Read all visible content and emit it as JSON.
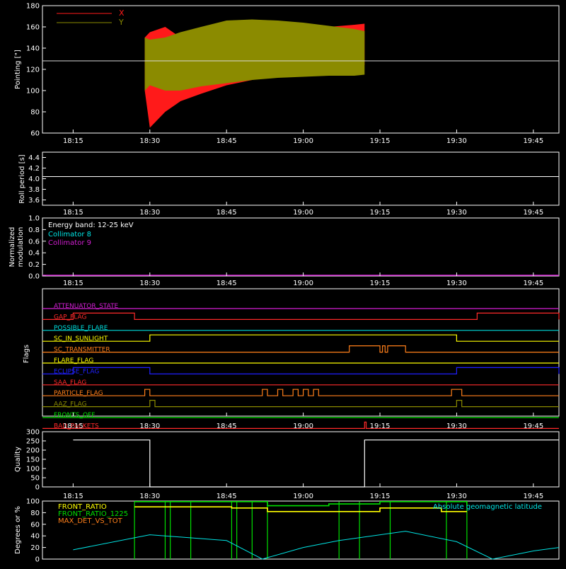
{
  "time_ticks": [
    "18:15",
    "18:30",
    "18:45",
    "19:00",
    "19:15",
    "19:30",
    "19:45"
  ],
  "colors": {
    "axis": "#ffffff",
    "x_series": "#ff1a1a",
    "y_series": "#8b8b00",
    "cyan": "#00e5e5",
    "magenta": "#d21fd2",
    "green": "#00e000",
    "yellow": "#ffff00",
    "orange": "#ff7f1a"
  },
  "chart_data": [
    {
      "type": "area",
      "id": "pointing",
      "ylabel": "Pointing [\"]",
      "ylim": [
        60,
        180
      ],
      "yticks": [
        "60",
        "80",
        "100",
        "120",
        "140",
        "160",
        "180"
      ],
      "legend": [
        {
          "name": "X",
          "color": "#ff1a1a"
        },
        {
          "name": "Y",
          "color": "#8b8b00"
        }
      ],
      "reference_line": 128,
      "data_start": "18:29",
      "data_end": "19:12",
      "series": [
        {
          "name": "X",
          "envelope": {
            "t": [
              "18:29",
              "18:30",
              "18:33",
              "18:36",
              "18:40",
              "18:45",
              "18:50",
              "18:55",
              "19:00",
              "19:05",
              "19:10",
              "19:12"
            ],
            "min": [
              100,
              65,
              80,
              90,
              97,
              105,
              110,
              115,
              118,
              121,
              123,
              124
            ],
            "max": [
              150,
              155,
              160,
              150,
              152,
              155,
              157,
              158,
              159,
              160,
              162,
              163
            ]
          }
        },
        {
          "name": "Y",
          "envelope": {
            "t": [
              "18:29",
              "18:30",
              "18:33",
              "18:36",
              "18:40",
              "18:45",
              "18:50",
              "18:55",
              "19:00",
              "19:05",
              "19:10",
              "19:12"
            ],
            "min": [
              100,
              105,
              100,
              100,
              104,
              107,
              110,
              112,
              113,
              114,
              114,
              115
            ],
            "max": [
              150,
              148,
              150,
              155,
              160,
              166,
              167,
              166,
              164,
              161,
              158,
              156
            ]
          }
        }
      ]
    },
    {
      "type": "line",
      "id": "roll",
      "ylabel": "Roll period [s]",
      "ylim": [
        3.5,
        4.5
      ],
      "yticks": [
        "3.6",
        "3.8",
        "4.0",
        "4.2",
        "4.4"
      ],
      "value": 4.04
    },
    {
      "type": "line",
      "id": "modulation",
      "ylabel": [
        "Normalized",
        "modulation"
      ],
      "ylim": [
        0,
        1
      ],
      "yticks": [
        "0.0",
        "0.2",
        "0.4",
        "0.6",
        "0.8",
        "1.0"
      ],
      "annotations": [
        {
          "text": "Energy band: 12-25 keV",
          "color": "#ffffff"
        },
        {
          "text": "Collimator 8",
          "color": "#00e5e5"
        },
        {
          "text": "Collimator 9",
          "color": "#d21fd2"
        }
      ],
      "baseline": 0
    },
    {
      "type": "line",
      "id": "flags",
      "ylabel": "Flags",
      "flags": [
        {
          "name": "ATTENUATOR_STATE",
          "color": "#d21fd2",
          "segments": []
        },
        {
          "name": "GAP_FLAG",
          "color": "#ff2a2a",
          "segments": [
            [
              "18:15",
              "18:27"
            ],
            [
              "19:34",
              "19:50"
            ]
          ]
        },
        {
          "name": "POSSIBLE_FLARE",
          "color": "#00dcdc",
          "segments": []
        },
        {
          "name": "SC_IN_SUNLIGHT",
          "color": "#ffff00",
          "segments": [
            [
              "18:30",
              "19:30"
            ]
          ]
        },
        {
          "name": "SC_TRANSMITTER",
          "color": "#ff7f1a",
          "segments": [
            [
              "19:09",
              "19:15"
            ],
            [
              "19:15.5",
              "19:16"
            ],
            [
              "19:16.5",
              "19:20"
            ]
          ]
        },
        {
          "name": "FLARE_FLAG",
          "color": "#ffff00",
          "segments": []
        },
        {
          "name": "ECLIPSE_FLAG",
          "color": "#2020ff",
          "segments": [
            [
              "18:15",
              "18:30"
            ],
            [
              "19:30",
              "19:50"
            ]
          ]
        },
        {
          "name": "SAA_FLAG",
          "color": "#ff2a2a",
          "segments": []
        },
        {
          "name": "PARTICLE_FLAG",
          "color": "#ff7f1a",
          "segments": [
            [
              "18:29",
              "18:30"
            ],
            [
              "18:52",
              "18:53"
            ],
            [
              "18:55",
              "18:56"
            ],
            [
              "18:58",
              "18:59"
            ],
            [
              "19:00",
              "19:01"
            ],
            [
              "19:02",
              "19:03"
            ],
            [
              "19:29",
              "19:31"
            ]
          ]
        },
        {
          "name": "AAZ_FLAG",
          "color": "#8b8b00",
          "segments": [
            [
              "18:30",
              "18:31"
            ],
            [
              "19:30",
              "19:31"
            ]
          ]
        },
        {
          "name": "FRONTS_OFF",
          "color": "#00e000",
          "segments": []
        },
        {
          "name": "BAD_PACKETS",
          "color": "#ff2a2a",
          "segments": [
            [
              "19:12",
              "19:12.3"
            ]
          ]
        }
      ]
    },
    {
      "type": "line",
      "id": "quality",
      "ylabel": "Quality",
      "ylim": [
        0,
        300
      ],
      "yticks": [
        "0",
        "50",
        "100",
        "150",
        "200",
        "250",
        "300"
      ],
      "segments": [
        {
          "t": [
            "18:15",
            "18:30"
          ],
          "value": 255
        },
        {
          "t": [
            "18:30",
            "19:12"
          ],
          "value": 0
        },
        {
          "t": [
            "19:12",
            "19:50"
          ],
          "value": 255
        }
      ]
    },
    {
      "type": "line",
      "id": "ratios",
      "ylabel": "Degrees or %",
      "ylim": [
        0,
        100
      ],
      "yticks": [
        "0",
        "20",
        "40",
        "60",
        "80",
        "100"
      ],
      "legend": [
        {
          "name": "FRONT_RATIO",
          "color": "#ffff00"
        },
        {
          "name": "FRONT_RATIO_1225",
          "color": "#00e000"
        },
        {
          "name": "MAX_DET_VS_TOT",
          "color": "#ff7f1a"
        }
      ],
      "right_label": {
        "text": "Absolute geomagnetic latitude",
        "color": "#00e5e5"
      },
      "series": [
        {
          "name": "Absolute geomagnetic latitude",
          "color": "#00e5e5",
          "t": [
            "18:15",
            "18:30",
            "18:45",
            "18:52",
            "19:00",
            "19:07",
            "19:20",
            "19:30",
            "19:37",
            "19:45",
            "19:50"
          ],
          "values": [
            16,
            42,
            32,
            0,
            20,
            32,
            48,
            30,
            0,
            14,
            20
          ]
        },
        {
          "name": "FRONT_RATIO_1225",
          "color": "#00e000",
          "t": [
            "18:27",
            "18:33",
            "18:46",
            "18:53",
            "19:05",
            "19:15",
            "19:25",
            "19:27",
            "19:32"
          ],
          "values": [
            99,
            99,
            99,
            92,
            95,
            99,
            99,
            99,
            92
          ]
        },
        {
          "name": "FRONT_RATIO",
          "color": "#ffff00",
          "t": [
            "18:27",
            "18:33",
            "18:46",
            "18:53",
            "19:05",
            "19:15",
            "19:25",
            "19:27",
            "19:32"
          ],
          "values": [
            90,
            90,
            88,
            82,
            82,
            88,
            88,
            82,
            82
          ]
        }
      ],
      "spikes_green": [
        "18:27",
        "18:33",
        "18:34",
        "18:38",
        "18:46",
        "18:47",
        "18:50",
        "18:53",
        "19:07",
        "19:11",
        "19:17",
        "19:28",
        "19:32"
      ]
    }
  ]
}
